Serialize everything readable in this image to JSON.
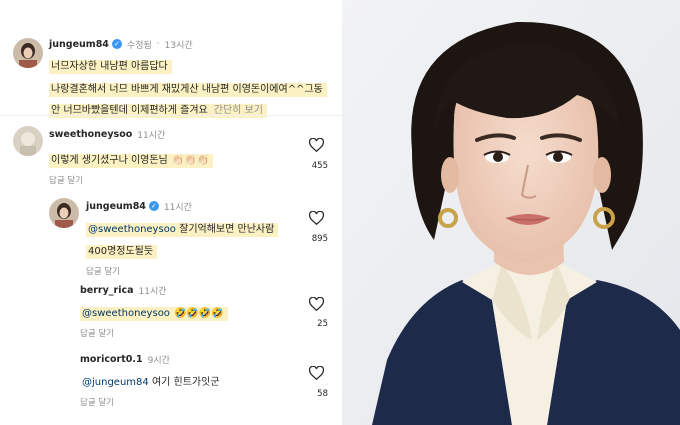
{
  "comments": [
    {
      "username": "jungeum84",
      "verified": true,
      "edited_label": "수정됨",
      "time": "13시간",
      "lines": [
        "너므자상한 내남편 아름답다",
        "나랑결혼해서 너므 바쁘게 재밌게산 내남편 이영돈이에여^^그동",
        "안 너므바빴을텐데 이제편하게 즐겨요"
      ],
      "more_label": "간단히 보기"
    },
    {
      "username": "sweethoneysoo",
      "time": "11시간",
      "text": "이렇게 생기셨구나 이영돈님",
      "emoji": "👏🏻👏🏻👏🏻",
      "reply_label": "답글 달기",
      "likes": "455"
    },
    {
      "username": "jungeum84",
      "verified": true,
      "time": "11시간",
      "mention": "@sweethoneysoo",
      "text": "잘기억해보면 만난사람",
      "line2": "400명정도될듯",
      "reply_label": "답글 달기",
      "likes": "895"
    },
    {
      "username": "berry_rica",
      "time": "11시간",
      "mention": "@sweethoneysoo",
      "emoji": "🤣🤣🤣🤣",
      "reply_label": "답글 달기",
      "likes": "25"
    },
    {
      "username": "moricort0.1",
      "time": "9시간",
      "mention": "@jungeum84",
      "text": "여기 힌트가잇군",
      "reply_label": "답글 달기",
      "likes": "58"
    }
  ],
  "icons": {
    "like": "heart-outline-icon",
    "verified": "verified-check-icon"
  },
  "colors": {
    "highlight": "#fbf1c2",
    "verified": "#3897f0",
    "muted": "#8e8e8e",
    "mention": "#00376b"
  }
}
